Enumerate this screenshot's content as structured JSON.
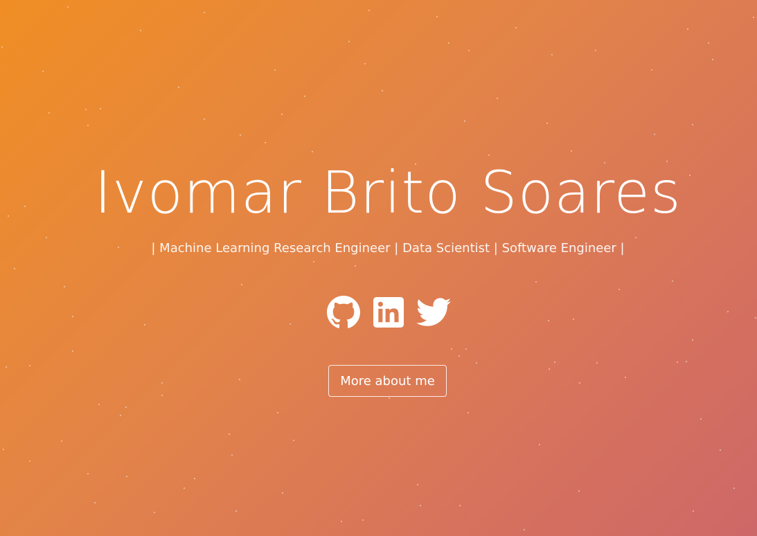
{
  "hero": {
    "name": "Ivomar Brito Soares",
    "tagline": "| Machine Learning Research Engineer | Data Scientist | Software Engineer |",
    "more_button_label": "More about me"
  },
  "social_links": [
    {
      "icon": "github-icon"
    },
    {
      "icon": "linkedin-icon"
    },
    {
      "icon": "twitter-icon"
    }
  ],
  "colors": {
    "gradient_start": "#f08e24",
    "gradient_end": "#cd6868",
    "text": "#ffffff"
  }
}
